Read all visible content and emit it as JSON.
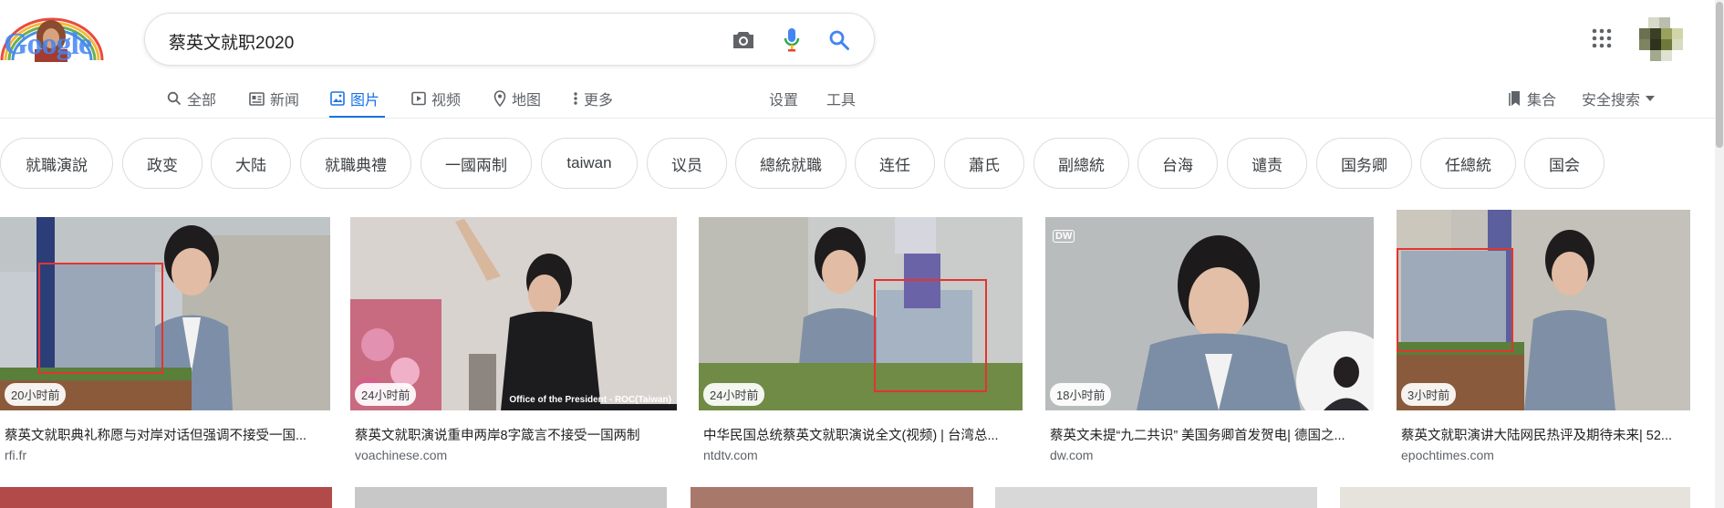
{
  "search": {
    "query": "蔡英文就职2020"
  },
  "logo": {
    "label": "Google"
  },
  "tabs": [
    {
      "label": "全部",
      "icon": "search-icon"
    },
    {
      "label": "新闻",
      "icon": "news-icon"
    },
    {
      "label": "图片",
      "icon": "image-icon",
      "active": true
    },
    {
      "label": "视频",
      "icon": "video-icon"
    },
    {
      "label": "地图",
      "icon": "map-pin-icon"
    },
    {
      "label": "更多",
      "icon": "more-vert-icon"
    },
    {
      "label": "设置"
    },
    {
      "label": "工具"
    }
  ],
  "right_tools": {
    "collections": "集合",
    "safe_search": "安全搜索"
  },
  "chips": [
    "就職演說",
    "政变",
    "大陆",
    "就職典禮",
    "一國兩制",
    "taiwan",
    "议员",
    "總統就職",
    "连任",
    "蕭氏",
    "副總統",
    "台海",
    "谴责",
    "国务卿",
    "任總統",
    "国会"
  ],
  "results": [
    {
      "time": "20小时前",
      "title": "蔡英文就职典礼称愿与对岸对话但强调不接受一国...",
      "domain": "rfi.fr"
    },
    {
      "time": "24小时前",
      "title": "蔡英文就职演说重申两岸8字箴言不接受一国两制",
      "domain": "voachinese.com",
      "caption": "Office of the President - ROC(Taiwan)"
    },
    {
      "time": "24小时前",
      "title": "中华民国总统蔡英文就职演说全文(视频) | 台湾总...",
      "domain": "ntdtv.com"
    },
    {
      "time": "18小时前",
      "title": "蔡英文未提“九二共识” 美国务卿首发贺电| 德国之...",
      "domain": "dw.com",
      "watermark": "DW"
    },
    {
      "time": "3小时前",
      "title": "蔡英文就职演讲大陆网民热评及期待未来| 52...",
      "domain": "epochtimes.com"
    }
  ],
  "colors": {
    "accent": "#1a73e8",
    "annotation_red": "#e3342f"
  }
}
